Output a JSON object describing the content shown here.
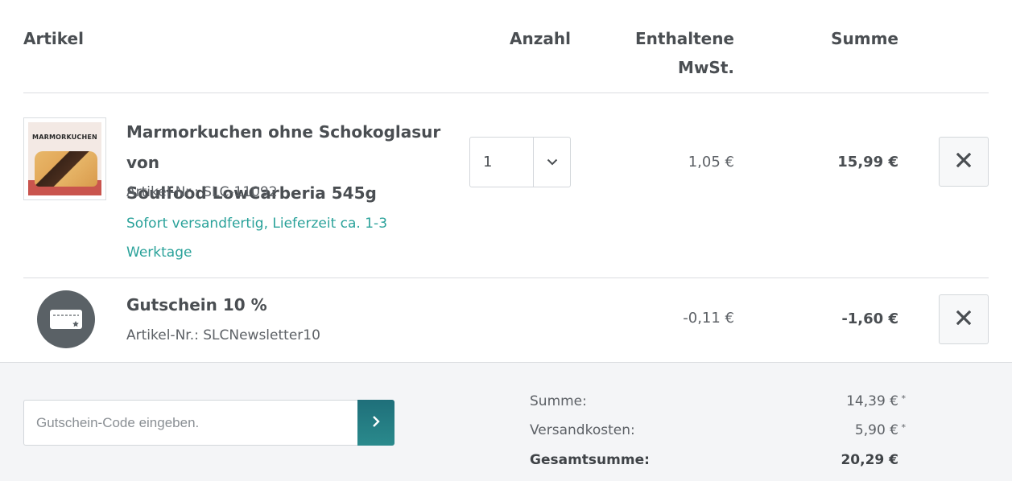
{
  "header": {
    "article": "Artikel",
    "quantity": "Anzahl",
    "tax_line1": "Enthaltene",
    "tax_line2": "MwSt.",
    "sum": "Summe"
  },
  "items": [
    {
      "thumbnail_title": "MARMORKUCHEN",
      "name_line1": "Marmorkuchen ohne Schokoglasur von",
      "name_line2": "Soulfood LowCarberia 545g",
      "sku": "Artikel-Nr.: SLC-11092",
      "delivery_line1": "Sofort versandfertig, Lieferzeit ca. 1-3",
      "delivery_line2": "Werktage",
      "quantity": "1",
      "tax": "1,05 €",
      "sum": "15,99 €"
    },
    {
      "icon": "voucher-card-icon",
      "name": "Gutschein 10 %",
      "sku": "Artikel-Nr.: SLCNewsletter10",
      "tax": "-0,11 €",
      "sum": "-1,60 €"
    }
  ],
  "voucher": {
    "placeholder": "Gutschein-Code eingeben."
  },
  "totals": {
    "subtotal_label": "Summe:",
    "subtotal_value": "14,39 €",
    "shipping_label": "Versandkosten:",
    "shipping_value": "5,90 €",
    "asterisk": "*",
    "grand_label": "Gesamtsumme:",
    "grand_value": "20,29 €"
  },
  "colors": {
    "accent": "#2aa29a",
    "button": "#1f6f7a",
    "text": "#4a4e52"
  }
}
